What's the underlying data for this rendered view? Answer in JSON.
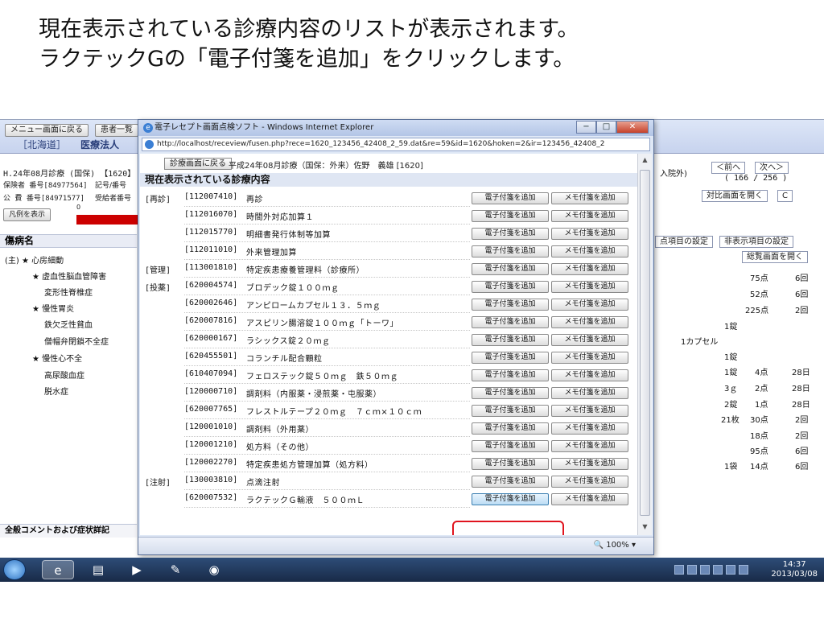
{
  "caption": {
    "line1": "現在表示されている診療内容のリストが表示されます。",
    "line2": "ラクテックGの「電子付箋を追加」をクリックします。"
  },
  "bg": {
    "menu_btn": "メニュー画面に戻る",
    "patient_btn": "患者一覧",
    "region": "［北海道］",
    "org": "医療法人",
    "header_line": "H.24年08月診療 (国保) 【1620】",
    "insurer": "保険者 番号[84977564]",
    "insurer2": "記号/番号",
    "public": "公 費 番号[84971577]",
    "public2": "受給者番号",
    "legend_btn": "凡例を表示",
    "zero": "0",
    "disease_title": "傷病名",
    "diseases": [
      {
        "prefix": "(主) ★",
        "name": "心房細動"
      },
      {
        "prefix": "★",
        "name": "虚血性脳血管障害"
      },
      {
        "prefix": "",
        "name": "変形性脊椎症"
      },
      {
        "prefix": "★",
        "name": "慢性胃炎"
      },
      {
        "prefix": "",
        "name": "鉄欠乏性貧血"
      },
      {
        "prefix": "",
        "name": "僧帽弁閉鎖不全症"
      },
      {
        "prefix": "★",
        "name": "慢性心不全"
      },
      {
        "prefix": "",
        "name": "高尿酸血症"
      },
      {
        "prefix": "",
        "name": "脱水症"
      }
    ],
    "comment_title": "全般コメントおよび症状詳記",
    "right": {
      "inpatient": "入院外)",
      "prev_btn": "＜前へ",
      "next_btn": "次へ＞",
      "page": "( 166 / 256 )",
      "compare_btn": "対比画面を開く",
      "c_btn": "C",
      "score_setting": "点項目の設定",
      "hidden_setting": "非表示項目の設定",
      "overview_btn": "総覧画面を開く",
      "rows": [
        {
          "a": "",
          "b": "75点",
          "c": "6回"
        },
        {
          "a": "",
          "b": "52点",
          "c": "6回"
        },
        {
          "a": "",
          "b": "225点",
          "c": "2回"
        },
        {
          "a": "1錠",
          "b": "",
          "c": ""
        },
        {
          "a": "1カプセル",
          "b": "",
          "c": ""
        },
        {
          "a": "1錠",
          "b": "",
          "c": ""
        },
        {
          "a": "1錠",
          "b": "4点",
          "c": "28日"
        },
        {
          "a": "3ｇ",
          "b": "2点",
          "c": "28日"
        },
        {
          "a": "2錠",
          "b": "1点",
          "c": "28日"
        },
        {
          "a": "21枚",
          "b": "30点",
          "c": "2回"
        },
        {
          "a": "",
          "b": "18点",
          "c": "2回"
        },
        {
          "a": "",
          "b": "95点",
          "c": "6回"
        },
        {
          "a": "1袋",
          "b": "14点",
          "c": "6回"
        }
      ]
    }
  },
  "ie": {
    "title": "電子レセプト画面点検ソフト - Windows Internet Explorer",
    "url": "http://localhost/receview/fusen.php?rece=1620_123456_42408_2_59.dat&re=59&id=1620&hoken=2&ir=123456_42408_2",
    "zoom": "100%",
    "back_btn": "診療画面に戻る",
    "head": "平成24年08月診療（国保：外来）佐野　義雄 [1620]",
    "section_title": "現在表示されている診療内容",
    "btn_e": "電子付箋を追加",
    "btn_m": "メモ付箋を追加",
    "rows": [
      {
        "cat": "[再診]",
        "code": "[112007410]",
        "name": "再診"
      },
      {
        "cat": "",
        "code": "[112016070]",
        "name": "時間外対応加算１"
      },
      {
        "cat": "",
        "code": "[112015770]",
        "name": "明細書発行体制等加算"
      },
      {
        "cat": "",
        "code": "[112011010]",
        "name": "外来管理加算"
      },
      {
        "cat": "[管理]",
        "code": "[113001810]",
        "name": "特定疾患療養管理料（診療所）"
      },
      {
        "cat": "[投薬]",
        "code": "[620004574]",
        "name": "ブロデック錠１００ｍｇ"
      },
      {
        "cat": "",
        "code": "[620002646]",
        "name": "アンピロームカプセル１３．５ｍｇ"
      },
      {
        "cat": "",
        "code": "[620007816]",
        "name": "アスピリン腸溶錠１００ｍｇ「トーワ」"
      },
      {
        "cat": "",
        "code": "[620000167]",
        "name": "ラシックス錠２０ｍｇ"
      },
      {
        "cat": "",
        "code": "[620455501]",
        "name": "コランチル配合顆粒"
      },
      {
        "cat": "",
        "code": "[610407094]",
        "name": "フェロステック錠５０ｍｇ　鉄５０ｍｇ"
      },
      {
        "cat": "",
        "code": "[120000710]",
        "name": "調剤料（内服薬・浸煎薬・屯服薬）"
      },
      {
        "cat": "",
        "code": "[620007765]",
        "name": "フレストルテープ２０ｍｇ　７ｃｍ×１０ｃｍ"
      },
      {
        "cat": "",
        "code": "[120001010]",
        "name": "調剤料（外用薬）"
      },
      {
        "cat": "",
        "code": "[120001210]",
        "name": "処方料（その他）"
      },
      {
        "cat": "",
        "code": "[120002270]",
        "name": "特定疾患処方管理加算（処方料）"
      },
      {
        "cat": "[注射]",
        "code": "[130003810]",
        "name": "点滴注射"
      },
      {
        "cat": "",
        "code": "[620007532]",
        "name": "ラクテックＧ輸液　５００ｍＬ"
      }
    ]
  },
  "taskbar": {
    "time": "14:37",
    "date": "2013/03/08"
  }
}
